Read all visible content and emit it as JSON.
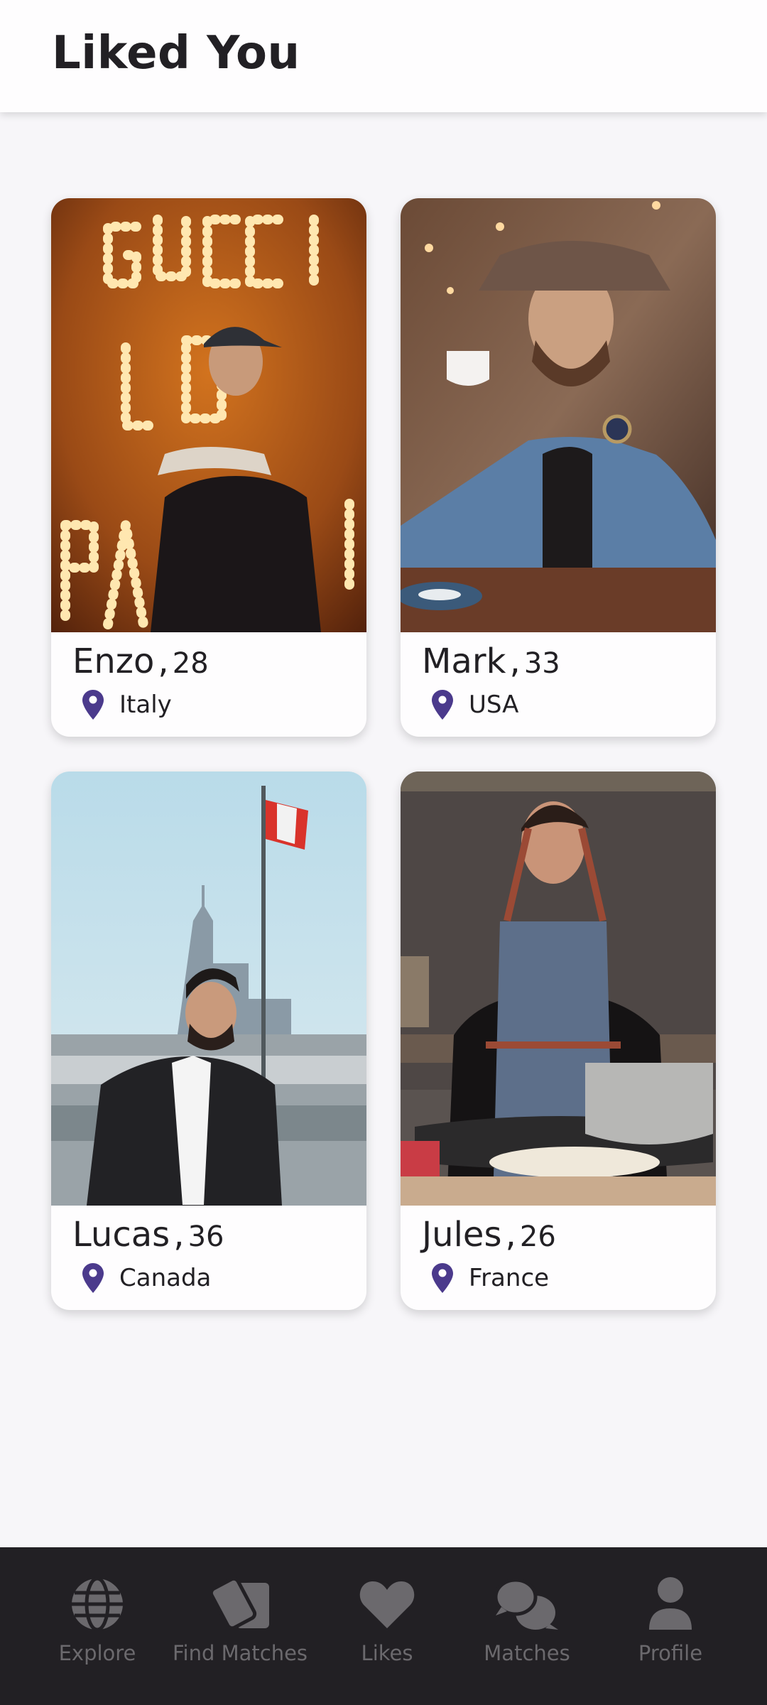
{
  "header": {
    "title": "Liked You"
  },
  "accent_color": "#4b3a8c",
  "profiles": [
    {
      "name": "Enzo",
      "separator": ",",
      "age": "28",
      "country": "Italy",
      "photo": "man-in-cap-before-gucci-love-parade-lights"
    },
    {
      "name": "Mark",
      "separator": ",",
      "age": "33",
      "country": "USA",
      "photo": "man-in-hat-denim-jacket-drinking-coffee"
    },
    {
      "name": "Lucas",
      "separator": ",",
      "age": "36",
      "country": "Canada",
      "photo": "man-in-suit-with-phone-canadian-flag"
    },
    {
      "name": "Jules",
      "separator": ",",
      "age": "26",
      "country": "France",
      "photo": "man-in-apron-cooking-crepes"
    }
  ],
  "bottom_nav": {
    "items": [
      {
        "label": "Explore",
        "icon": "globe-icon"
      },
      {
        "label": "Find Matches",
        "icon": "cards-icon"
      },
      {
        "label": "Likes",
        "icon": "heart-icon"
      },
      {
        "label": "Matches",
        "icon": "chat-bubbles-icon"
      },
      {
        "label": "Profile",
        "icon": "person-icon"
      }
    ]
  }
}
